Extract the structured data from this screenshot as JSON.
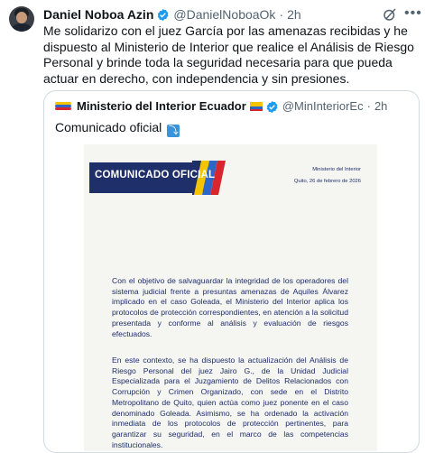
{
  "tweet": {
    "author_name": "Daniel Noboa Azin",
    "author_handle": "@DanielNoboaOk",
    "separator": "·",
    "time": "2h",
    "text": "Me solidarizo con el juez García por las amenazas recibidas y he dispuesto al Ministerio de Interior que realice el Análisis de Riesgo Personal y brinde toda la seguridad necesaria para que pueda actuar en derecho, con independencia y sin presiones.",
    "more_icon": "•••",
    "grok_icon": "grok-icon"
  },
  "quote": {
    "author_name": "Ministerio del Interior Ecuador",
    "author_handle": "@MinInteriorEc",
    "separator": "·",
    "time": "2h",
    "text": "Comunicado oficial",
    "emoji_icon": "⤵"
  },
  "document": {
    "banner": "COMUNICADO OFICIAL",
    "ministry": "Ministerio del Interior",
    "place_date": "Quito, 26 de febrero de 2026",
    "paragraph1": "Con el objetivo de salvaguardar la integridad de los operadores del sistema judicial frente a presuntas amenazas de Aquiles Álvarez implicado en el caso Goleada, el Ministerio del Interior aplica los protocolos de protección correspondientes, en atención a la solicitud presentada y conforme al análisis y evaluación de riesgos efectuados.",
    "paragraph2": "En este contexto, se ha dispuesto la actualización del Análisis de Riesgo Personal del juez Jairo G., de la Unidad Judicial Especializada para el Juzgamiento de Delitos Relacionados con Corrupción y Crimen Organizado, con sede en el Distrito Metropolitano de Quito, quien actúa como juez ponente en el caso denominado Goleada. Asimismo, se ha ordenado la activación inmediata de los protocolos de protección pertinentes, para garantizar su seguridad, en el marco de las competencias institucionales."
  },
  "colors": {
    "verified": "#1d9bf0",
    "navy": "#1f2f6a",
    "yellow": "#f5c400",
    "blue": "#2e66c7",
    "red": "#d7262e"
  }
}
